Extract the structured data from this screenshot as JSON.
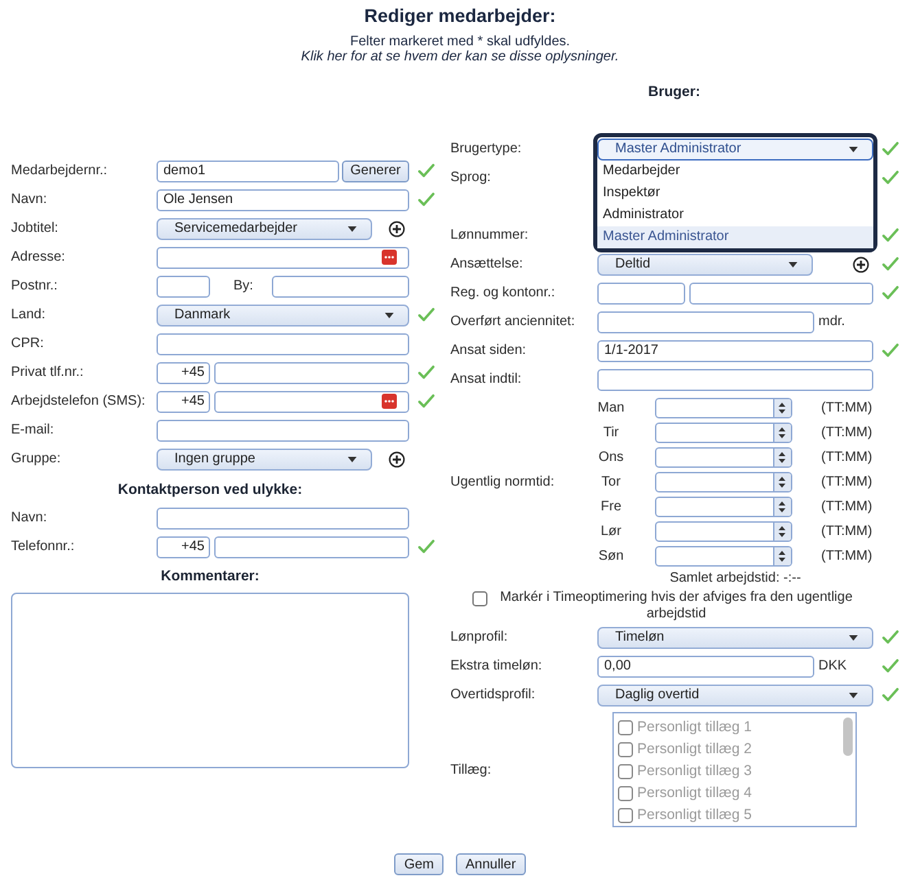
{
  "header": {
    "title": "Rediger medarbejder:",
    "note": "Felter markeret med * skal udfyldes.",
    "link": "Klik her for at se hvem der kan se disse oplysninger."
  },
  "employee": {
    "fields": [
      {
        "kind": "text",
        "label": "Medarbejdernr.:",
        "value": "demo1",
        "button": "Generer",
        "valid": true
      },
      {
        "kind": "text",
        "label": "Navn:",
        "value": "Ole Jensen",
        "valid": true
      },
      {
        "kind": "select",
        "label": "Jobtitel:",
        "value": "Servicemedarbejder",
        "open": false,
        "add_button": true,
        "valid": false
      },
      {
        "kind": "text",
        "label": "Adresse:",
        "autofill": true,
        "valid": false
      },
      {
        "kind": "postcode",
        "label": "Postnr.:",
        "second_label": "By:",
        "valid": false
      },
      {
        "kind": "select",
        "label": "Land:",
        "value": "Danmark",
        "open": false,
        "valid": true
      },
      {
        "kind": "text",
        "label": "CPR:",
        "valid": false
      },
      {
        "kind": "phone",
        "label": "Privat tlf.nr.:",
        "prefix": "+45",
        "valid": true
      },
      {
        "kind": "phone",
        "label": "Arbejdstelefon (SMS):",
        "prefix": "+45",
        "autofill": true,
        "valid": true
      },
      {
        "kind": "text",
        "label": "E-mail:",
        "valid": false
      },
      {
        "kind": "select",
        "label": "Gruppe:",
        "value": "Ingen gruppe",
        "open": false,
        "add_button": true,
        "valid": false
      }
    ]
  },
  "contact": {
    "heading": "Kontaktperson ved ulykke:",
    "fields": [
      {
        "kind": "text",
        "label": "Navn:",
        "valid": false
      },
      {
        "kind": "phone",
        "label": "Telefonnr.:",
        "prefix": "+45",
        "valid": true
      }
    ]
  },
  "comments": {
    "heading": "Kommentarer:"
  },
  "user": {
    "heading": "Bruger:",
    "fields": [
      {
        "kind": "select",
        "label": "Brugertype:",
        "value": "Master Administrator",
        "open": true,
        "options": [
          {
            "label": "Medarbejder",
            "selected": false
          },
          {
            "label": "Inspektør",
            "selected": false
          },
          {
            "label": "Administrator",
            "selected": false
          },
          {
            "label": "Master Administrator",
            "selected": true
          }
        ],
        "valid": true
      },
      {
        "kind": "block",
        "label": "Sprog:",
        "valid": true
      },
      {
        "kind": "covered",
        "label": "Lønnummer:",
        "valid": true
      },
      {
        "kind": "select",
        "label": "Ansættelse:",
        "value": "Deltid",
        "open": false,
        "add_button": true,
        "valid": true
      },
      {
        "kind": "split",
        "label": "Reg. og kontonr.:",
        "valid": true
      },
      {
        "kind": "unit",
        "label": "Overført anciennitet:",
        "unit": "mdr.",
        "valid": false
      },
      {
        "kind": "text",
        "label": "Ansat siden:",
        "value": "1/1-2017",
        "valid": true
      },
      {
        "kind": "text",
        "label": "Ansat indtil:",
        "valid": false
      }
    ],
    "weekly": {
      "label": "Ugentlig normtid:",
      "days": [
        {
          "day": "Man",
          "unit": "(TT:MM)"
        },
        {
          "day": "Tir",
          "unit": "(TT:MM)"
        },
        {
          "day": "Ons",
          "unit": "(TT:MM)"
        },
        {
          "day": "Tor",
          "unit": "(TT:MM)"
        },
        {
          "day": "Fre",
          "unit": "(TT:MM)"
        },
        {
          "day": "Lør",
          "unit": "(TT:MM)"
        },
        {
          "day": "Søn",
          "unit": "(TT:MM)"
        }
      ],
      "total": "Samlet arbejdstid: -:--"
    },
    "deviation": {
      "label": "Markér i Timeoptimering hvis der afviges fra den ugentlige arbejdstid",
      "checked": false
    },
    "pay_fields": [
      {
        "kind": "select",
        "label": "Lønprofil:",
        "value": "Timeløn",
        "open": false,
        "valid": true
      },
      {
        "kind": "unit",
        "label": "Ekstra timeløn:",
        "value": "0,00",
        "unit": "DKK",
        "valid": true
      },
      {
        "kind": "select",
        "label": "Overtidsprofil:",
        "value": "Daglig overtid",
        "open": false,
        "valid": true
      }
    ],
    "supplements": {
      "label": "Tillæg:",
      "items": [
        {
          "label": "Personligt tillæg 1",
          "checked": false,
          "disabled": true
        },
        {
          "label": "Personligt tillæg 2",
          "checked": false,
          "disabled": true
        },
        {
          "label": "Personligt tillæg 3",
          "checked": false,
          "disabled": true
        },
        {
          "label": "Personligt tillæg 4",
          "checked": false,
          "disabled": true
        },
        {
          "label": "Personligt tillæg 5",
          "checked": false,
          "disabled": true
        }
      ]
    }
  },
  "buttons": [
    "Gem",
    "Annuller"
  ]
}
